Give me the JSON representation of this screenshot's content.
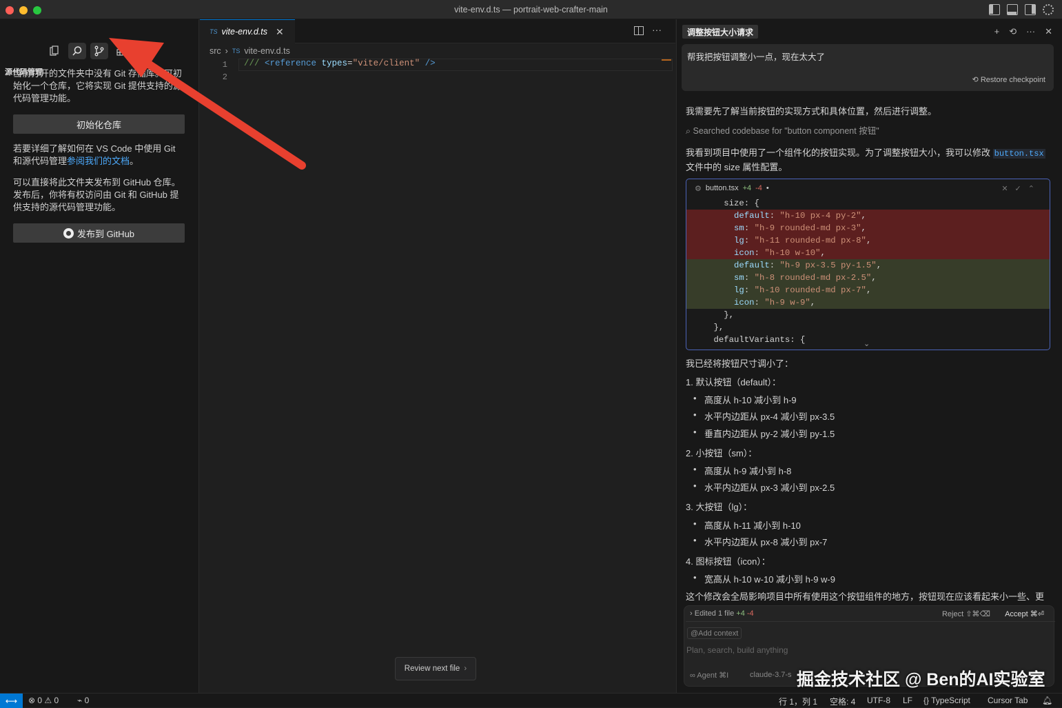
{
  "window": {
    "title": "vite-env.d.ts — portrait-web-crafter-main"
  },
  "sidebar": {
    "title": "源代码管理",
    "p1": "当前打开的文件夹中没有 Git 存储库。可初始化一个仓库，它将实现 Git 提供支持的源代码管理功能。",
    "init_button": "初始化仓库",
    "p2_prefix": "若要详细了解如何在 VS Code 中使用 Git 和源代码管理",
    "p2_link": "参阅我们的文档",
    "p2_suffix": "。",
    "p3": "可以直接将此文件夹发布到 GitHub 仓库。发布后，你将有权访问由 Git 和 GitHub 提供支持的源代码管理功能。",
    "publish_button": "发布到 GitHub"
  },
  "editor": {
    "tab_lang": "TS",
    "tab_label": "vite-env.d.ts",
    "breadcrumb_folder": "src",
    "breadcrumb_lang": "TS",
    "breadcrumb_file": "vite-env.d.ts",
    "line1": "1",
    "line2": "2",
    "code_comment": "/// ",
    "code_tag": "<reference",
    "code_attr": " types",
    "code_eq": "=",
    "code_val": "\"vite/client\"",
    "code_close": " />",
    "review_button": "Review next file"
  },
  "chat": {
    "tab_title": "调整按钮大小请求",
    "user_message": "帮我把按钮调整小一点，现在太大了",
    "restore": "Restore checkpoint",
    "msg1": "我需要先了解当前按钮的实现方式和具体位置，然后进行调整。",
    "search": "Searched codebase for \"button component 按钮\"",
    "msg2_a": "我看到项目中使用了一个组件化的按钮实现。为了调整按钮大小，我可以修改",
    "msg2_file": "button.tsx",
    "msg2_b": "文件中的 size 属性配置。",
    "card_file": "button.tsx",
    "card_add": "+4",
    "card_del": "-4",
    "code_lines": [
      {
        "t": "      size: {",
        "k": "n"
      },
      {
        "t": "        default: \"h-10 px-4 py-2\",",
        "k": "d"
      },
      {
        "t": "        sm: \"h-9 rounded-md px-3\",",
        "k": "d"
      },
      {
        "t": "        lg: \"h-11 rounded-md px-8\",",
        "k": "d"
      },
      {
        "t": "        icon: \"h-10 w-10\",",
        "k": "d"
      },
      {
        "t": "        default: \"h-9 px-3.5 py-1.5\",",
        "k": "a"
      },
      {
        "t": "        sm: \"h-8 rounded-md px-2.5\",",
        "k": "a"
      },
      {
        "t": "        lg: \"h-10 rounded-md px-7\",",
        "k": "a"
      },
      {
        "t": "        icon: \"h-9 w-9\",",
        "k": "a"
      },
      {
        "t": "      },",
        "k": "n"
      },
      {
        "t": "    },",
        "k": "n"
      },
      {
        "t": "    defaultVariants: {",
        "k": "n"
      }
    ],
    "done": "我已经将按钮尺寸调小了：",
    "g1": "1. 默认按钮（default）：",
    "g1a": "高度从 h-10 减小到 h-9",
    "g1b": "水平内边距从 px-4 减小到 px-3.5",
    "g1c": "垂直内边距从 py-2 减小到 py-1.5",
    "g2": "2. 小按钮（sm）：",
    "g2a": "高度从 h-9 减小到 h-8",
    "g2b": "水平内边距从 px-3 减小到 px-2.5",
    "g3": "3. 大按钮（lg）：",
    "g3a": "高度从 h-11 减小到 h-10",
    "g3b": "水平内边距从 px-8 减小到 px-7",
    "g4": "4. 图标按钮（icon）：",
    "g4a": "宽高从 h-10 w-10 减小到 h-9 w-9",
    "last": "这个修改会全局影响项目中所有使用这个按钮组件的地方，按钮现在应该看起来小一些、更",
    "edited": "Edited 1 file",
    "edited_add": "+4",
    "edited_del": "-4",
    "reject": "Reject ⇧⌘⌫",
    "accept": "Accept ⌘⏎",
    "add_context": "Add context",
    "placeholder": "Plan, search, build anything",
    "agent": "Agent ⌘I",
    "model": "claude-3.7-s"
  },
  "status": {
    "errors": "0",
    "warnings": "0",
    "ports": "0",
    "position": "行 1，列 1",
    "spaces": "空格: 4",
    "encoding": "UTF-8",
    "eol": "LF",
    "language": "TypeScript",
    "cursor_tab": "Cursor Tab"
  },
  "watermark": "掘金技术社区 @ Ben的AI实验室",
  "colors": {
    "accent": "#0078d4",
    "arrow": "#e8402f",
    "diff_del": "#5c1f1f",
    "diff_add": "#373d29"
  }
}
